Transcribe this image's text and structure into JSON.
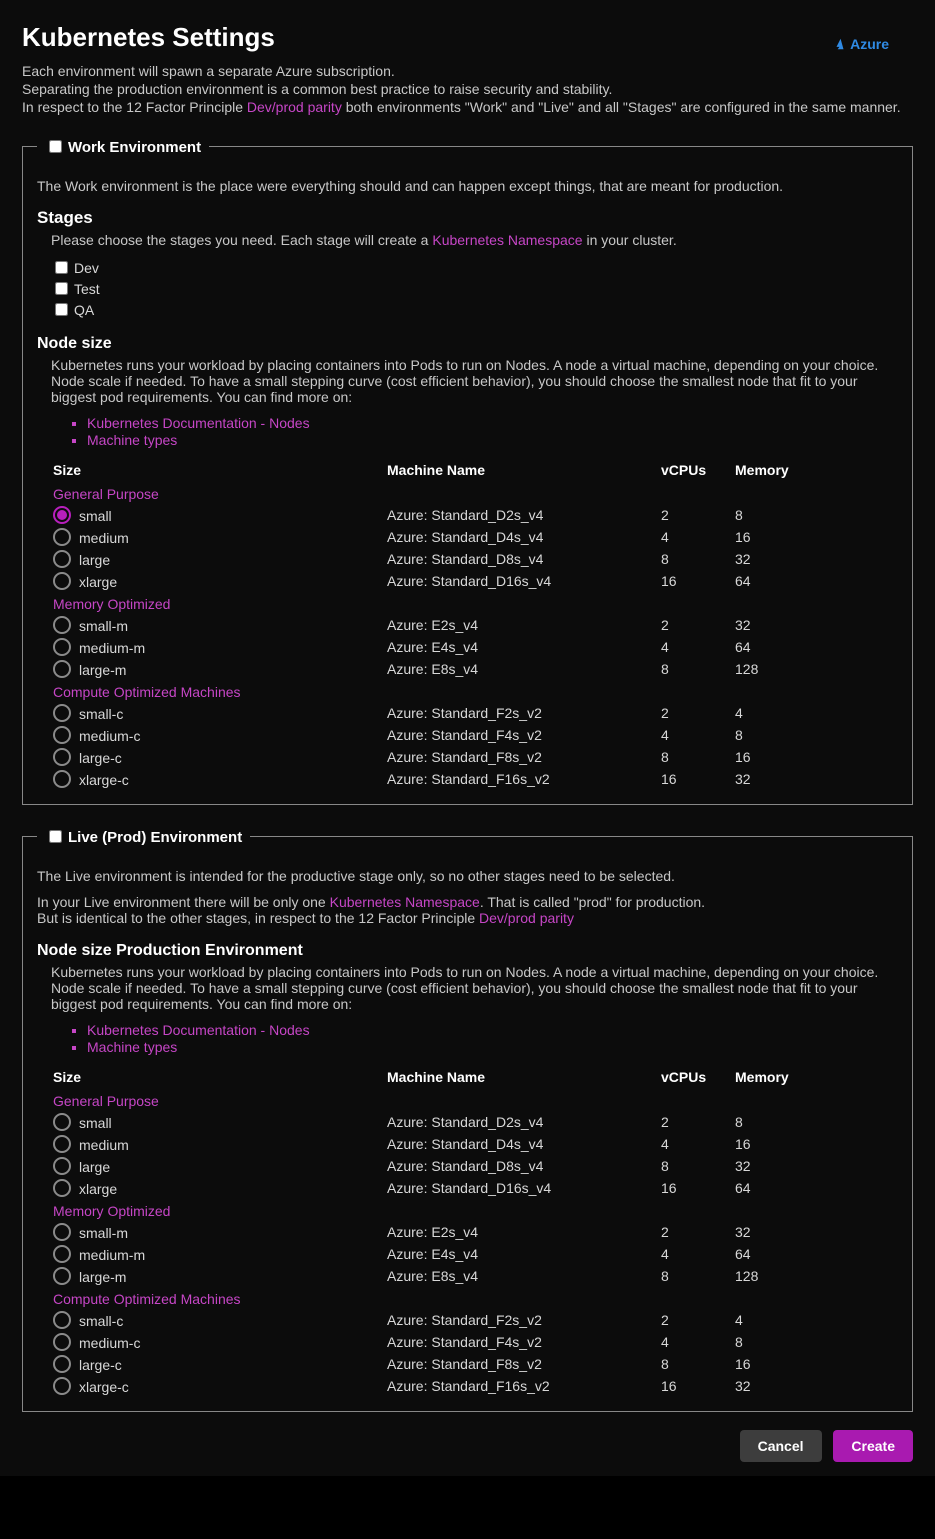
{
  "header": {
    "title": "Kubernetes Settings",
    "azure_label": "Azure",
    "intro_l1": "Each environment will spawn a separate Azure subscription.",
    "intro_l2": "Separating the production environment is a common best practice to raise security and stability.",
    "intro_l3a": "In respect to the 12 Factor Principle ",
    "intro_l3_link": "Dev/prod parity",
    "intro_l3b": " both environments \"Work\" and \"Live\" and all \"Stages\" are configured in the same manner."
  },
  "work": {
    "legend": "Work Environment",
    "desc": "The Work environment is the place were everything should and can happen except things, that are meant for production.",
    "stages": {
      "heading": "Stages",
      "help_a": "Please choose the stages you need. Each stage will create a ",
      "help_link": "Kubernetes Namespace",
      "help_b": " in your cluster.",
      "items": [
        {
          "label": "Dev",
          "checked": false
        },
        {
          "label": "Test",
          "checked": false
        },
        {
          "label": "QA",
          "checked": false
        }
      ]
    },
    "nodesize": {
      "heading": "Node size",
      "desc": "Kubernetes runs your workload by placing containers into Pods to run on Nodes. A node a virtual machine, depending on your choice. Node scale if needed. To have a small stepping curve (cost efficient behavior), you should choose the smallest node that fit to your biggest pod requirements. You can find more on:",
      "links": [
        "Kubernetes Documentation - Nodes",
        "Machine types"
      ],
      "columns": {
        "size": "Size",
        "machine": "Machine Name",
        "vcpus": "vCPUs",
        "memory": "Memory"
      },
      "categories": [
        {
          "name": "General Purpose",
          "rows": [
            {
              "sel": true,
              "size": "small",
              "machine": "Azure: Standard_D2s_v4",
              "vcpus": "2",
              "memory": "8"
            },
            {
              "sel": false,
              "size": "medium",
              "machine": "Azure: Standard_D4s_v4",
              "vcpus": "4",
              "memory": "16"
            },
            {
              "sel": false,
              "size": "large",
              "machine": "Azure: Standard_D8s_v4",
              "vcpus": "8",
              "memory": "32"
            },
            {
              "sel": false,
              "size": "xlarge",
              "machine": "Azure: Standard_D16s_v4",
              "vcpus": "16",
              "memory": "64"
            }
          ]
        },
        {
          "name": "Memory Optimized",
          "rows": [
            {
              "sel": false,
              "size": "small-m",
              "machine": "Azure: E2s_v4",
              "vcpus": "2",
              "memory": "32"
            },
            {
              "sel": false,
              "size": "medium-m",
              "machine": "Azure: E4s_v4",
              "vcpus": "4",
              "memory": "64"
            },
            {
              "sel": false,
              "size": "large-m",
              "machine": "Azure: E8s_v4",
              "vcpus": "8",
              "memory": "128"
            }
          ]
        },
        {
          "name": "Compute Optimized Machines",
          "rows": [
            {
              "sel": false,
              "size": "small-c",
              "machine": "Azure: Standard_F2s_v2",
              "vcpus": "2",
              "memory": "4"
            },
            {
              "sel": false,
              "size": "medium-c",
              "machine": "Azure: Standard_F4s_v2",
              "vcpus": "4",
              "memory": "8"
            },
            {
              "sel": false,
              "size": "large-c",
              "machine": "Azure: Standard_F8s_v2",
              "vcpus": "8",
              "memory": "16"
            },
            {
              "sel": false,
              "size": "xlarge-c",
              "machine": "Azure: Standard_F16s_v2",
              "vcpus": "16",
              "memory": "32"
            }
          ]
        }
      ]
    }
  },
  "live": {
    "legend": "Live (Prod) Environment",
    "desc": "The Live environment is intended for the productive stage only, so no other stages need to be selected.",
    "desc2_a": "In your Live environment there will be only one ",
    "desc2_link": "Kubernetes Namespace",
    "desc2_b": ". That is called \"prod\" for production.",
    "desc3_a": "But is identical to the other stages, in respect to the 12 Factor Principle ",
    "desc3_link": "Dev/prod parity",
    "nodesize": {
      "heading": "Node size Production Environment",
      "desc": "Kubernetes runs your workload by placing containers into Pods to run on Nodes. A node a virtual machine, depending on your choice. Node scale if needed. To have a small stepping curve (cost efficient behavior), you should choose the smallest node that fit to your biggest pod requirements. You can find more on:",
      "links": [
        "Kubernetes Documentation - Nodes",
        "Machine types"
      ],
      "columns": {
        "size": "Size",
        "machine": "Machine Name",
        "vcpus": "vCPUs",
        "memory": "Memory"
      },
      "categories": [
        {
          "name": "General Purpose",
          "rows": [
            {
              "sel": false,
              "size": "small",
              "machine": "Azure: Standard_D2s_v4",
              "vcpus": "2",
              "memory": "8"
            },
            {
              "sel": false,
              "size": "medium",
              "machine": "Azure: Standard_D4s_v4",
              "vcpus": "4",
              "memory": "16"
            },
            {
              "sel": false,
              "size": "large",
              "machine": "Azure: Standard_D8s_v4",
              "vcpus": "8",
              "memory": "32"
            },
            {
              "sel": false,
              "size": "xlarge",
              "machine": "Azure: Standard_D16s_v4",
              "vcpus": "16",
              "memory": "64"
            }
          ]
        },
        {
          "name": "Memory Optimized",
          "rows": [
            {
              "sel": false,
              "size": "small-m",
              "machine": "Azure: E2s_v4",
              "vcpus": "2",
              "memory": "32"
            },
            {
              "sel": false,
              "size": "medium-m",
              "machine": "Azure: E4s_v4",
              "vcpus": "4",
              "memory": "64"
            },
            {
              "sel": false,
              "size": "large-m",
              "machine": "Azure: E8s_v4",
              "vcpus": "8",
              "memory": "128"
            }
          ]
        },
        {
          "name": "Compute Optimized Machines",
          "rows": [
            {
              "sel": false,
              "size": "small-c",
              "machine": "Azure: Standard_F2s_v2",
              "vcpus": "2",
              "memory": "4"
            },
            {
              "sel": false,
              "size": "medium-c",
              "machine": "Azure: Standard_F4s_v2",
              "vcpus": "4",
              "memory": "8"
            },
            {
              "sel": false,
              "size": "large-c",
              "machine": "Azure: Standard_F8s_v2",
              "vcpus": "8",
              "memory": "16"
            },
            {
              "sel": false,
              "size": "xlarge-c",
              "machine": "Azure: Standard_F16s_v2",
              "vcpus": "16",
              "memory": "32"
            }
          ]
        }
      ]
    }
  },
  "buttons": {
    "cancel": "Cancel",
    "create": "Create"
  }
}
